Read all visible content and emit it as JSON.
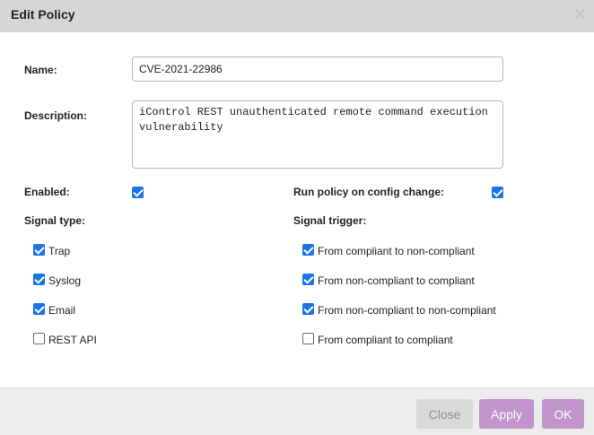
{
  "dialog": {
    "title": "Edit Policy",
    "close_icon": "close-icon"
  },
  "form": {
    "name_label": "Name:",
    "name_value": "CVE-2021-22986",
    "description_label": "Description:",
    "description_value": "iControl REST unauthenticated remote command execution vulnerability",
    "enabled_label": "Enabled:",
    "enabled": true,
    "run_on_change_label": "Run policy on config change:",
    "run_on_change": true,
    "signal_type_label": "Signal type:",
    "signal_trigger_label": "Signal trigger:",
    "signal_types": [
      {
        "label": "Trap",
        "checked": true
      },
      {
        "label": "Syslog",
        "checked": true
      },
      {
        "label": "Email",
        "checked": true
      },
      {
        "label": "REST API",
        "checked": false
      }
    ],
    "signal_triggers": [
      {
        "label": "From compliant to non-compliant",
        "checked": true
      },
      {
        "label": "From non-compliant to compliant",
        "checked": true
      },
      {
        "label": "From non-compliant to non-compliant",
        "checked": true
      },
      {
        "label": "From compliant to compliant",
        "checked": false
      }
    ]
  },
  "footer": {
    "close_label": "Close",
    "apply_label": "Apply",
    "ok_label": "OK"
  },
  "colors": {
    "accent": "#c195cb",
    "checkbox": "#1a73e8",
    "titlebar": "#d6d6d6"
  }
}
